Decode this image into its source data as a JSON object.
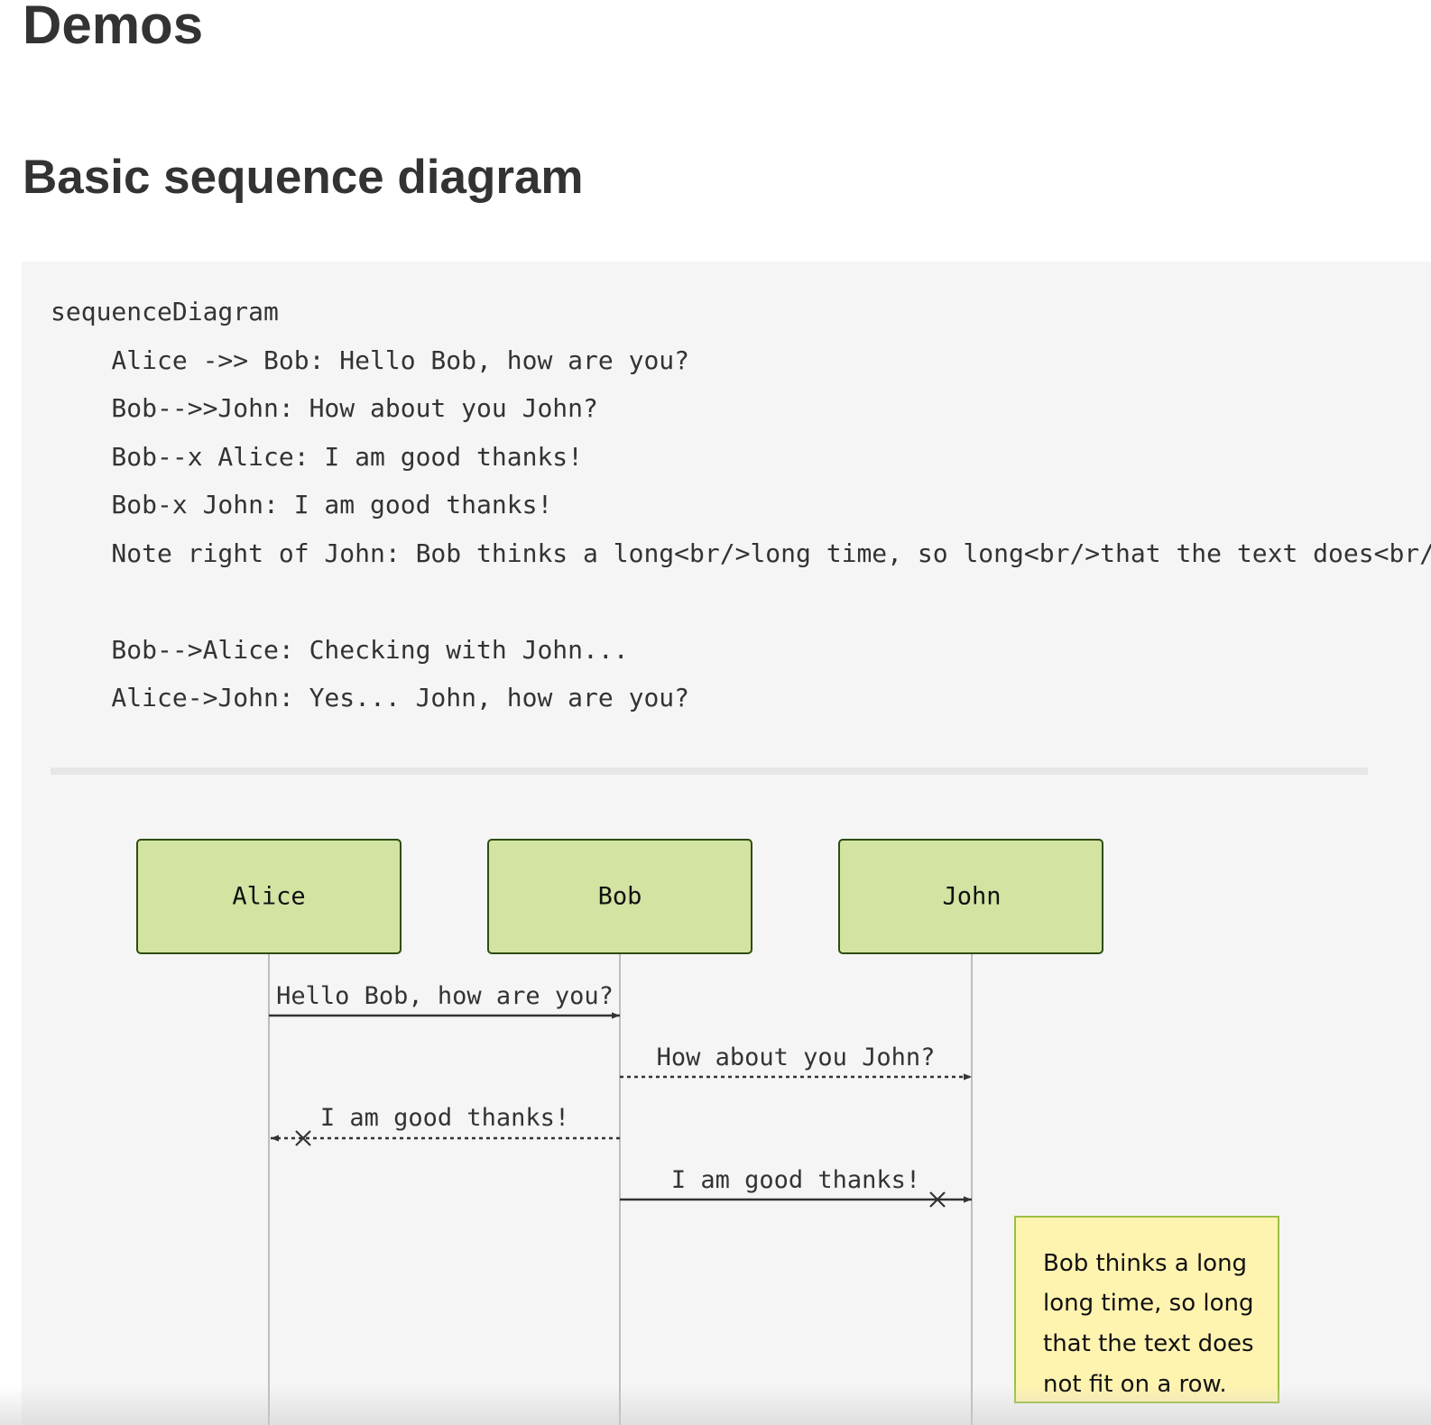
{
  "page": {
    "title": "Demos",
    "section_title": "Basic sequence diagram"
  },
  "code_block": {
    "lines": [
      "sequenceDiagram",
      "    Alice ->> Bob: Hello Bob, how are you?",
      "    Bob-->>John: How about you John?",
      "    Bob--x Alice: I am good thanks!",
      "    Bob-x John: I am good thanks!",
      "    Note right of John: Bob thinks a long<br/>long time, so long<br/>that the text does<br/>not fit on a row.",
      "",
      "    Bob-->Alice: Checking with John...",
      "    Alice->John: Yes... John, how are you?"
    ]
  },
  "diagram": {
    "actors": [
      "Alice",
      "Bob",
      "John"
    ],
    "messages": [
      {
        "from": "Alice",
        "to": "Bob",
        "text": "Hello Bob, how are you?",
        "line": "solid",
        "head": "arrow"
      },
      {
        "from": "Bob",
        "to": "John",
        "text": "How about you John?",
        "line": "dotted",
        "head": "arrow"
      },
      {
        "from": "Bob",
        "to": "Alice",
        "text": "I am good thanks!",
        "line": "dotted",
        "head": "cross"
      },
      {
        "from": "Bob",
        "to": "John",
        "text": "I am good thanks!",
        "line": "solid",
        "head": "cross"
      }
    ],
    "note": {
      "position": "right of John",
      "lines": [
        "Bob thinks a long",
        "long time, so long",
        "that the text does",
        "not fit on a row."
      ]
    },
    "colors": {
      "actor_fill": "#d2e3a2",
      "actor_border": "#2e4d12",
      "note_fill": "#fff3b0",
      "note_border": "#9cbf45",
      "line": "#333333",
      "panel_background": "#f5f5f5"
    }
  }
}
